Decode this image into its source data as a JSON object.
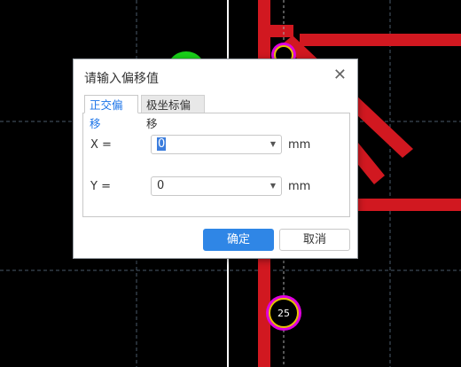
{
  "canvas": {
    "pad_top_label": "25"
  },
  "dialog": {
    "title": "请输入偏移值",
    "tabs": [
      {
        "label": "正交偏移",
        "active": true
      },
      {
        "label": "极坐标偏移",
        "active": false
      }
    ],
    "fields": [
      {
        "label": "X =",
        "value": "0",
        "unit": "mm",
        "selected": true
      },
      {
        "label": "Y =",
        "value": "0",
        "unit": "mm",
        "selected": false
      }
    ],
    "ok_label": "确定",
    "cancel_label": "取消"
  },
  "colors": {
    "background": "#000000",
    "track": "#d11820",
    "pad_ring": "#e6c200",
    "pad_inner": "#e000e0",
    "green_shape": "#19d019",
    "accent": "#2f86e6"
  },
  "icons": {
    "close": "close-icon",
    "dropdown": "chevron-down-icon"
  }
}
